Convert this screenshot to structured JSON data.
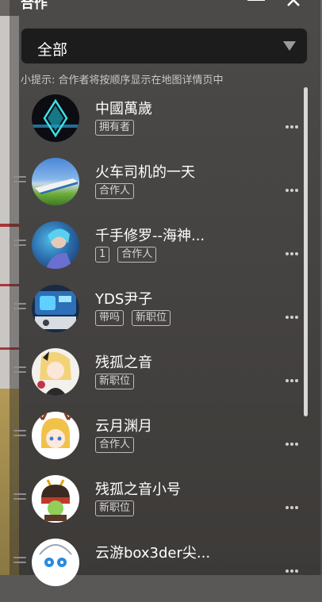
{
  "header": {
    "title": "合作"
  },
  "filter": {
    "selected": "全部"
  },
  "tip": "小提示: 合作者将按顺序显示在地图详情页中",
  "members": [
    {
      "name": "中國萬歲",
      "tags": [
        "拥有者"
      ],
      "avatar": "diamond-avatar"
    },
    {
      "name": "火车司机的一天",
      "tags": [
        "合作人"
      ],
      "avatar": "train-avatar"
    },
    {
      "name": "千手修罗--海神...",
      "tags": [
        "1",
        "合作人"
      ],
      "avatar": "character-avatar"
    },
    {
      "name": "YDS尹子",
      "tags": [
        "带吗",
        "新职位"
      ],
      "avatar": "machine-avatar"
    },
    {
      "name": "残孤之音",
      "tags": [
        "新职位"
      ],
      "avatar": "anime-girl-avatar"
    },
    {
      "name": "云月渊月",
      "tags": [
        "合作人"
      ],
      "avatar": "chibi-avatar"
    },
    {
      "name": "残孤之音小号",
      "tags": [
        "新职位"
      ],
      "avatar": "samurai-avatar"
    },
    {
      "name": "云游box3der尖...",
      "tags": [],
      "avatar": "blue-eyes-avatar"
    }
  ]
}
